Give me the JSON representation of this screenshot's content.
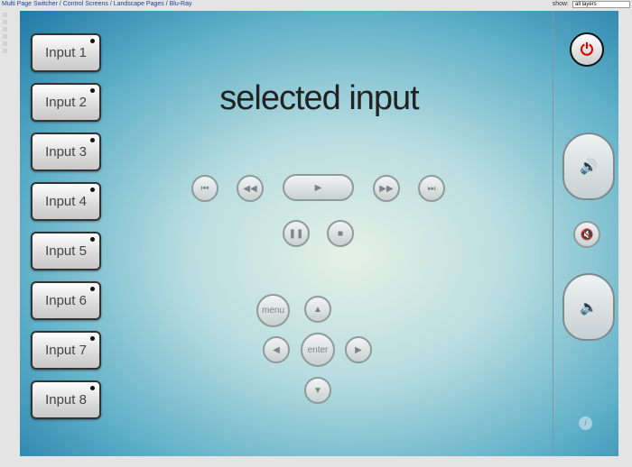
{
  "topbar": {
    "breadcrumb": "Multi Page Switcher / Control Screens / Landscape Pages / Blu-Ray",
    "show_label": "show:",
    "layers_value": "all layers"
  },
  "inputs": [
    "Input 1",
    "Input 2",
    "Input 3",
    "Input 4",
    "Input 5",
    "Input 6",
    "Input 7",
    "Input 8"
  ],
  "title": "selected input",
  "transport": {
    "prev": "⏮",
    "rewind": "◀◀",
    "play": "▶",
    "forward": "▶▶",
    "next": "⏭",
    "pause": "❚❚",
    "stop": "■"
  },
  "nav": {
    "menu": "menu",
    "enter": "enter",
    "up": "▲",
    "down": "▼",
    "left": "◀",
    "right": "▶"
  },
  "side": {
    "power": "⏻",
    "vol_up": "🔊",
    "mute": "🔇",
    "vol_down": "🔈",
    "info": "i"
  },
  "colors": {
    "power": "#dd0000"
  }
}
